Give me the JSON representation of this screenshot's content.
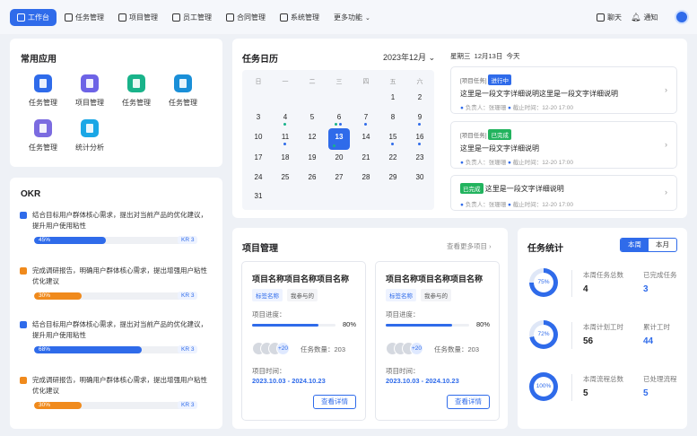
{
  "nav": {
    "items": [
      {
        "label": "工作台"
      },
      {
        "label": "任务管理"
      },
      {
        "label": "项目管理"
      },
      {
        "label": "员工管理"
      },
      {
        "label": "合同管理"
      },
      {
        "label": "系统管理"
      },
      {
        "label": "更多功能"
      }
    ],
    "chat": "聊天",
    "notify": "通知"
  },
  "apps": {
    "title": "常用应用",
    "items": [
      {
        "label": "任务管理",
        "color": "#2f6bea"
      },
      {
        "label": "项目管理",
        "color": "#6d63e6"
      },
      {
        "label": "任务管理",
        "color": "#19b38a"
      },
      {
        "label": "任务管理",
        "color": "#1a8fd8"
      },
      {
        "label": "任务管理",
        "color": "#7b6be0"
      },
      {
        "label": "统计分析",
        "color": "#1aa7e6"
      }
    ]
  },
  "okr": {
    "title": "OKR",
    "items": [
      {
        "text": "结合目标用户群体核心需求，提出对当前产品的优化建议，提升用户使用粘性",
        "pct": "45%",
        "value": 0.45,
        "color": "#2f6bea",
        "kr": "KR 3"
      },
      {
        "text": "完成调研报告，明确用户群体核心需求，提出增强用户粘性优化建议",
        "pct": "30%",
        "value": 0.3,
        "color": "#f08a1c",
        "kr": "KR 3"
      },
      {
        "text": "结合目标用户群体核心需求，提出对当前产品的优化建议，提升用户使用粘性",
        "pct": "68%",
        "value": 0.68,
        "color": "#2f6bea",
        "kr": "KR 3"
      },
      {
        "text": "完成调研报告，明确用户群体核心需求，提出增强用户粘性优化建议",
        "pct": "30%",
        "value": 0.3,
        "color": "#f08a1c",
        "kr": "KR 3"
      }
    ]
  },
  "calendar": {
    "title": "任务日历",
    "month": "2023年12月",
    "weekdays": [
      "日",
      "一",
      "二",
      "三",
      "四",
      "五",
      "六"
    ],
    "rows": [
      [
        "",
        "",
        "",
        "",
        "",
        "1",
        "2"
      ],
      [
        "3",
        "4",
        "5",
        "6",
        "7",
        "8",
        "9"
      ],
      [
        "10",
        "11",
        "12",
        "13",
        "14",
        "15",
        "16"
      ],
      [
        "17",
        "18",
        "19",
        "20",
        "21",
        "22",
        "23"
      ],
      [
        "24",
        "25",
        "26",
        "27",
        "28",
        "29",
        "30"
      ],
      [
        "31",
        "",
        "",
        "",
        "",
        "",
        ""
      ]
    ],
    "today": "13",
    "date_header": {
      "weekday": "星期三",
      "date": "12月13日",
      "today": "今天"
    }
  },
  "tasks": [
    {
      "project": "[项目任务]",
      "status": "进行中",
      "title": "这里是一段文字详细说明这里是一段文字详细说明",
      "owner": "负责人：张珊珊",
      "deadline": "截止时间：12-20 17:00"
    },
    {
      "project": "[项目任务]",
      "status": "已完成",
      "title": "这里是一段文字详细说明",
      "owner": "负责人：张珊珊",
      "deadline": "截止时间：12-20 17:00"
    },
    {
      "status": "已完成",
      "title": "这里是一段文字详细说明",
      "owner": "负责人：张珊珊",
      "deadline": "截止时间：12-20 17:00"
    }
  ],
  "projects": {
    "title": "项目管理",
    "more": "查看更多项目",
    "items": [
      {
        "name": "项目名称项目名称项目名称",
        "tag1": "标签名称",
        "tag2": "我参与的",
        "progress_label": "项目进度：",
        "progress": "80%",
        "progress_value": 0.8,
        "avatars_more": "+20",
        "task_count": "任务数量：203",
        "time_label": "项目时间：",
        "time": "2023.10.03 - 2024.10.23",
        "button": "查看详情"
      },
      {
        "name": "项目名称项目名称项目名称",
        "tag1": "标签名称",
        "tag2": "我参与的",
        "progress_label": "项目进度：",
        "progress": "80%",
        "progress_value": 0.8,
        "avatars_more": "+20",
        "task_count": "任务数量：203",
        "time_label": "项目时间：",
        "time": "2023.10.03 - 2024.10.23",
        "button": "查看详情"
      }
    ]
  },
  "stats": {
    "title": "任务统计",
    "tabs": [
      "本周",
      "本月"
    ],
    "rows": [
      {
        "pct": "75%",
        "value": 0.75,
        "l1": "本周任务总数",
        "v1": "4",
        "l2": "已完成任务",
        "v2": "3"
      },
      {
        "pct": "72%",
        "value": 0.72,
        "l1": "本周计划工时",
        "v1": "56",
        "l2": "累计工时",
        "v2": "44"
      },
      {
        "pct": "100%",
        "value": 1.0,
        "l1": "本周流程总数",
        "v1": "5",
        "l2": "已处理流程",
        "v2": "5"
      }
    ]
  }
}
